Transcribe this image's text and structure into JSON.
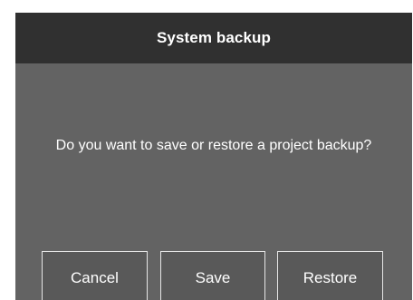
{
  "dialog": {
    "title": "System backup",
    "message": "Do you want to save or restore a project backup?",
    "buttons": {
      "cancel": "Cancel",
      "save": "Save",
      "restore": "Restore"
    }
  },
  "colors": {
    "dialog_background": "#636363",
    "header_background": "#303030",
    "button_border": "#e6e6e6",
    "text": "#ffffff"
  }
}
